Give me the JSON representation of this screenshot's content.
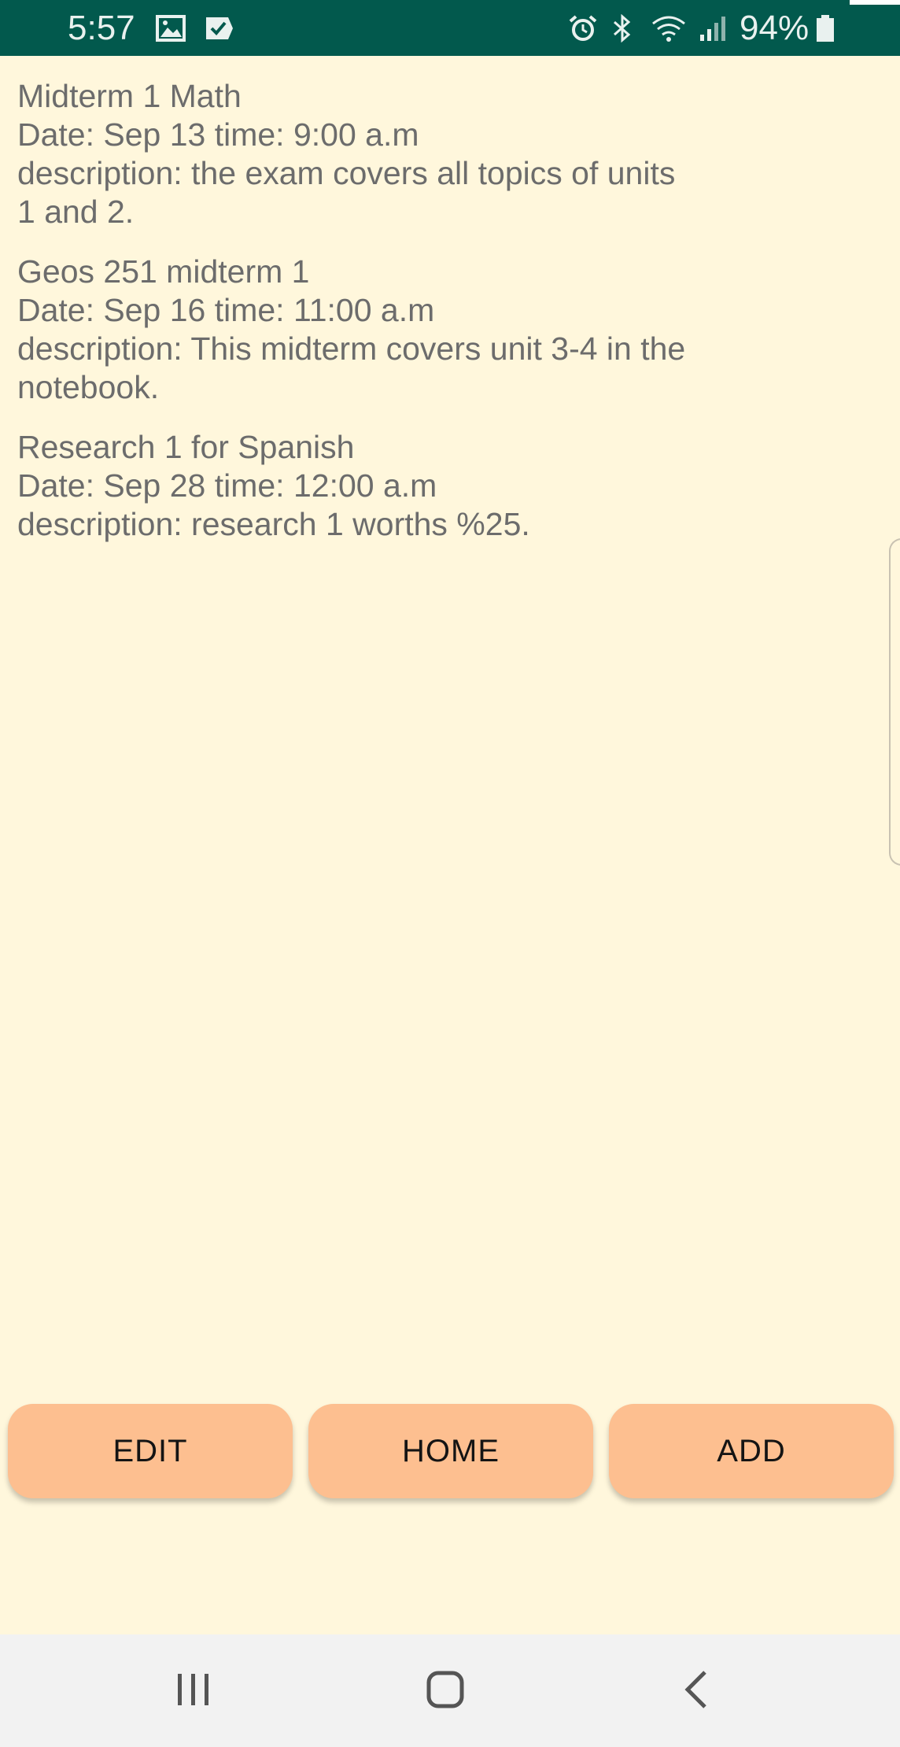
{
  "status_bar": {
    "time": "5:57",
    "battery": "94%",
    "icons": [
      "gallery-icon",
      "checkmark-notification-icon",
      "alarm-icon",
      "bluetooth-icon",
      "wifi-icon",
      "signal-icon",
      "battery-icon"
    ],
    "background_color": "#02594d"
  },
  "events": [
    {
      "title": "Midterm 1 Math",
      "date_line": "Date: Sep 13 time: 9:00 a.m",
      "description_line": "description: the exam covers all topics of units 1 and 2."
    },
    {
      "title": "Geos 251 midterm 1",
      "date_line": "Date: Sep 16 time: 11:00 a.m",
      "description_line": "description: This midterm covers unit 3-4 in the notebook."
    },
    {
      "title": "Research 1 for Spanish",
      "date_line": "Date: Sep 28 time: 12:00 a.m",
      "description_line": "description: research 1 worths %25."
    }
  ],
  "buttons": {
    "edit": "EDIT",
    "home": "HOME",
    "add": "ADD",
    "color": "#fdbf90"
  },
  "nav_bar": {
    "icons": [
      "recent-apps-icon",
      "home-icon",
      "back-icon"
    ]
  },
  "page_background": "#fff7dc"
}
